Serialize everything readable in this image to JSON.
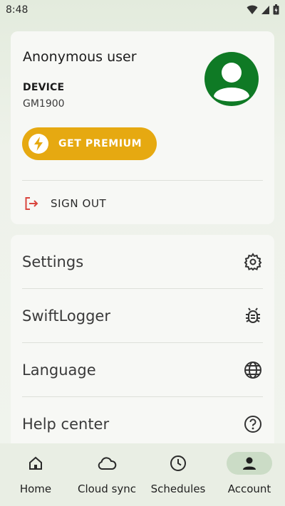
{
  "status_bar": {
    "time": "8:48"
  },
  "profile": {
    "user_name": "Anonymous user",
    "device_label": "DEVICE",
    "device_value": "GM1900",
    "premium_label": "GET PREMIUM",
    "signout_label": "SIGN OUT"
  },
  "menu": {
    "items": [
      {
        "label": "Settings",
        "icon": "gear-icon"
      },
      {
        "label": "SwiftLogger",
        "icon": "bug-icon"
      },
      {
        "label": "Language",
        "icon": "globe-icon"
      },
      {
        "label": "Help center",
        "icon": "help-icon"
      }
    ]
  },
  "bottom_nav": {
    "items": [
      {
        "label": "Home",
        "icon": "home-icon",
        "active": false
      },
      {
        "label": "Cloud sync",
        "icon": "cloud-icon",
        "active": false
      },
      {
        "label": "Schedules",
        "icon": "clock-icon",
        "active": false
      },
      {
        "label": "Account",
        "icon": "person-icon",
        "active": true
      }
    ]
  },
  "colors": {
    "premium": "#e6a911",
    "avatar": "#0f7a25",
    "signout_icon": "#d9463e",
    "nav_active": "#cbdcc6"
  }
}
